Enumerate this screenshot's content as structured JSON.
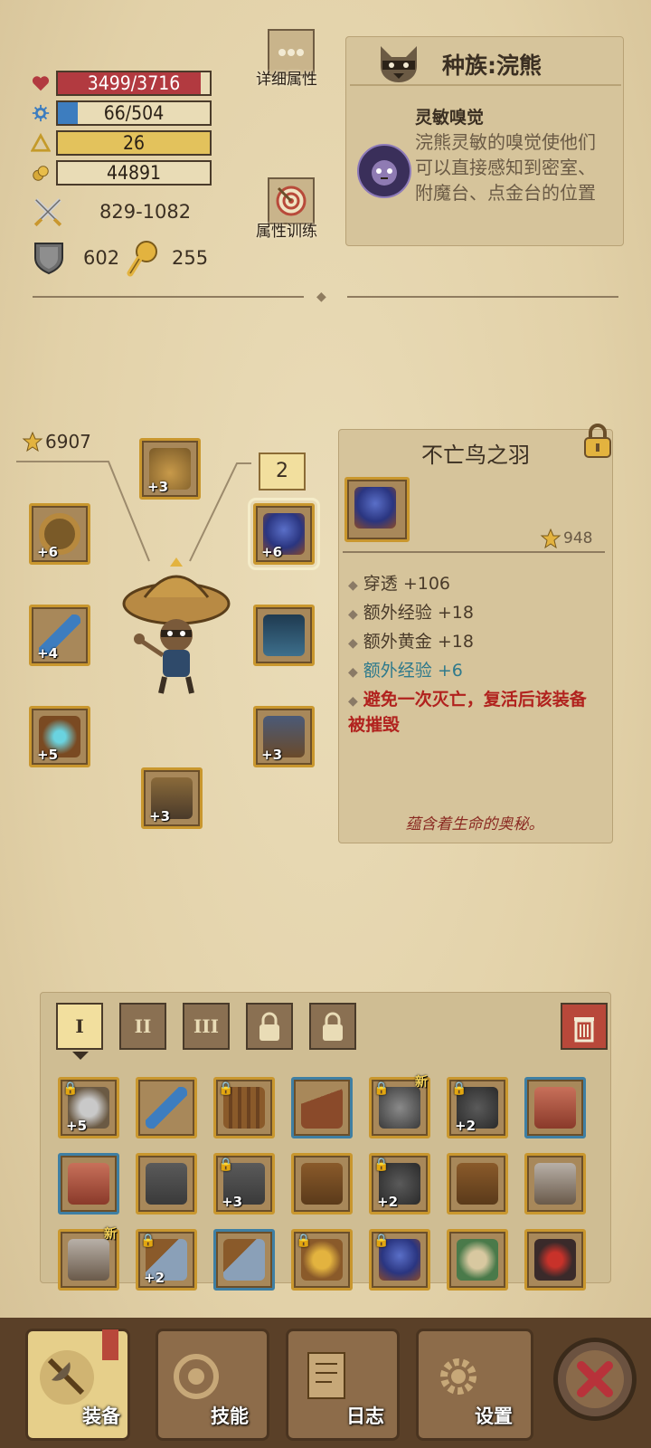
{
  "stats": {
    "hp": "3499/3716",
    "mp": "66/504",
    "level": "26",
    "gold": "44891",
    "attack": "829-1082",
    "defense": "602",
    "power": "255",
    "hp_fraction": 0.94,
    "mp_fraction": 0.13,
    "colors": {
      "hp": "#b23a40",
      "mp": "#3d7dbf",
      "level": "#e3c25c"
    }
  },
  "buttons": {
    "detail_attrs": "详细属性",
    "attr_training": "属性训练"
  },
  "race": {
    "title": "种族:浣熊",
    "trait_name": "灵敏嗅觉",
    "trait_desc": "浣熊灵敏的嗅觉使他们可以直接感知到密室、附魔台、点金台的位置"
  },
  "equipment": {
    "score": "6907",
    "badge_count": "2",
    "slots": [
      {
        "name": "helmet",
        "plus": "+3"
      },
      {
        "name": "ring",
        "plus": "+6"
      },
      {
        "name": "feather",
        "plus": "+6"
      },
      {
        "name": "weapon",
        "plus": "+4"
      },
      {
        "name": "cape",
        "plus": ""
      },
      {
        "name": "scroll",
        "plus": "+5"
      },
      {
        "name": "pants",
        "plus": "+3"
      },
      {
        "name": "boots",
        "plus": "+3"
      }
    ]
  },
  "item_detail": {
    "name": "不亡鸟之羽",
    "score": "948",
    "attrs": [
      {
        "label": "穿透 +106",
        "color": "#4a3b2a"
      },
      {
        "label": "额外经验 +18",
        "color": "#4a3b2a"
      },
      {
        "label": "额外黄金 +18",
        "color": "#4a3b2a"
      },
      {
        "label": "额外经验 +6",
        "color": "#2f7a8c"
      }
    ],
    "special": "避免一次灭亡，复活后该装备被摧毁",
    "flavor": "蕴含着生命的奥秘。"
  },
  "inventory": {
    "tabs": [
      "I",
      "II",
      "III"
    ],
    "new_label": "新",
    "items": [
      {
        "icon": "axe-icon",
        "plus": "+5",
        "locked": true,
        "new": false,
        "frame": "gold"
      },
      {
        "icon": "staff-icon",
        "plus": "",
        "locked": false,
        "new": false,
        "frame": "gold"
      },
      {
        "icon": "barrel-helmet-icon",
        "plus": "",
        "locked": true,
        "new": false,
        "frame": "gold"
      },
      {
        "icon": "witch-hat-icon",
        "plus": "",
        "locked": false,
        "new": false,
        "frame": "blue"
      },
      {
        "icon": "knight-helmet-icon",
        "plus": "",
        "locked": true,
        "new": true,
        "frame": "gold"
      },
      {
        "icon": "armor-icon",
        "plus": "+2",
        "locked": true,
        "new": false,
        "frame": "gold"
      },
      {
        "icon": "shirt-icon",
        "plus": "",
        "locked": false,
        "new": false,
        "frame": "blue"
      },
      {
        "icon": "shirt-icon",
        "plus": "",
        "locked": false,
        "new": false,
        "frame": "blue"
      },
      {
        "icon": "pants-icon",
        "plus": "",
        "locked": false,
        "new": false,
        "frame": "gold"
      },
      {
        "icon": "pants-icon",
        "plus": "+3",
        "locked": true,
        "new": false,
        "frame": "gold"
      },
      {
        "icon": "boots-icon",
        "plus": "",
        "locked": false,
        "new": false,
        "frame": "gold"
      },
      {
        "icon": "spiked-armor-icon",
        "plus": "+2",
        "locked": true,
        "new": false,
        "frame": "gold"
      },
      {
        "icon": "boots-icon",
        "plus": "",
        "locked": false,
        "new": false,
        "frame": "gold"
      },
      {
        "icon": "greaves-icon",
        "plus": "",
        "locked": false,
        "new": false,
        "frame": "gold"
      },
      {
        "icon": "greaves-icon",
        "plus": "",
        "locked": false,
        "new": true,
        "frame": "gold"
      },
      {
        "icon": "gauntlet-icon",
        "plus": "+2",
        "locked": true,
        "new": false,
        "frame": "gold"
      },
      {
        "icon": "gauntlet-icon",
        "plus": "",
        "locked": false,
        "new": false,
        "frame": "blue"
      },
      {
        "icon": "money-bag-icon",
        "plus": "",
        "locked": true,
        "new": false,
        "frame": "gold"
      },
      {
        "icon": "feather-icon",
        "plus": "",
        "locked": true,
        "new": false,
        "frame": "gold"
      },
      {
        "icon": "thorn-scroll-icon",
        "plus": "",
        "locked": false,
        "new": false,
        "frame": "gold"
      },
      {
        "icon": "ruby-ring-icon",
        "plus": "",
        "locked": false,
        "new": false,
        "frame": "gold"
      }
    ]
  },
  "nav": {
    "equip": "装备",
    "skills": "技能",
    "log": "日志",
    "settings": "设置"
  }
}
